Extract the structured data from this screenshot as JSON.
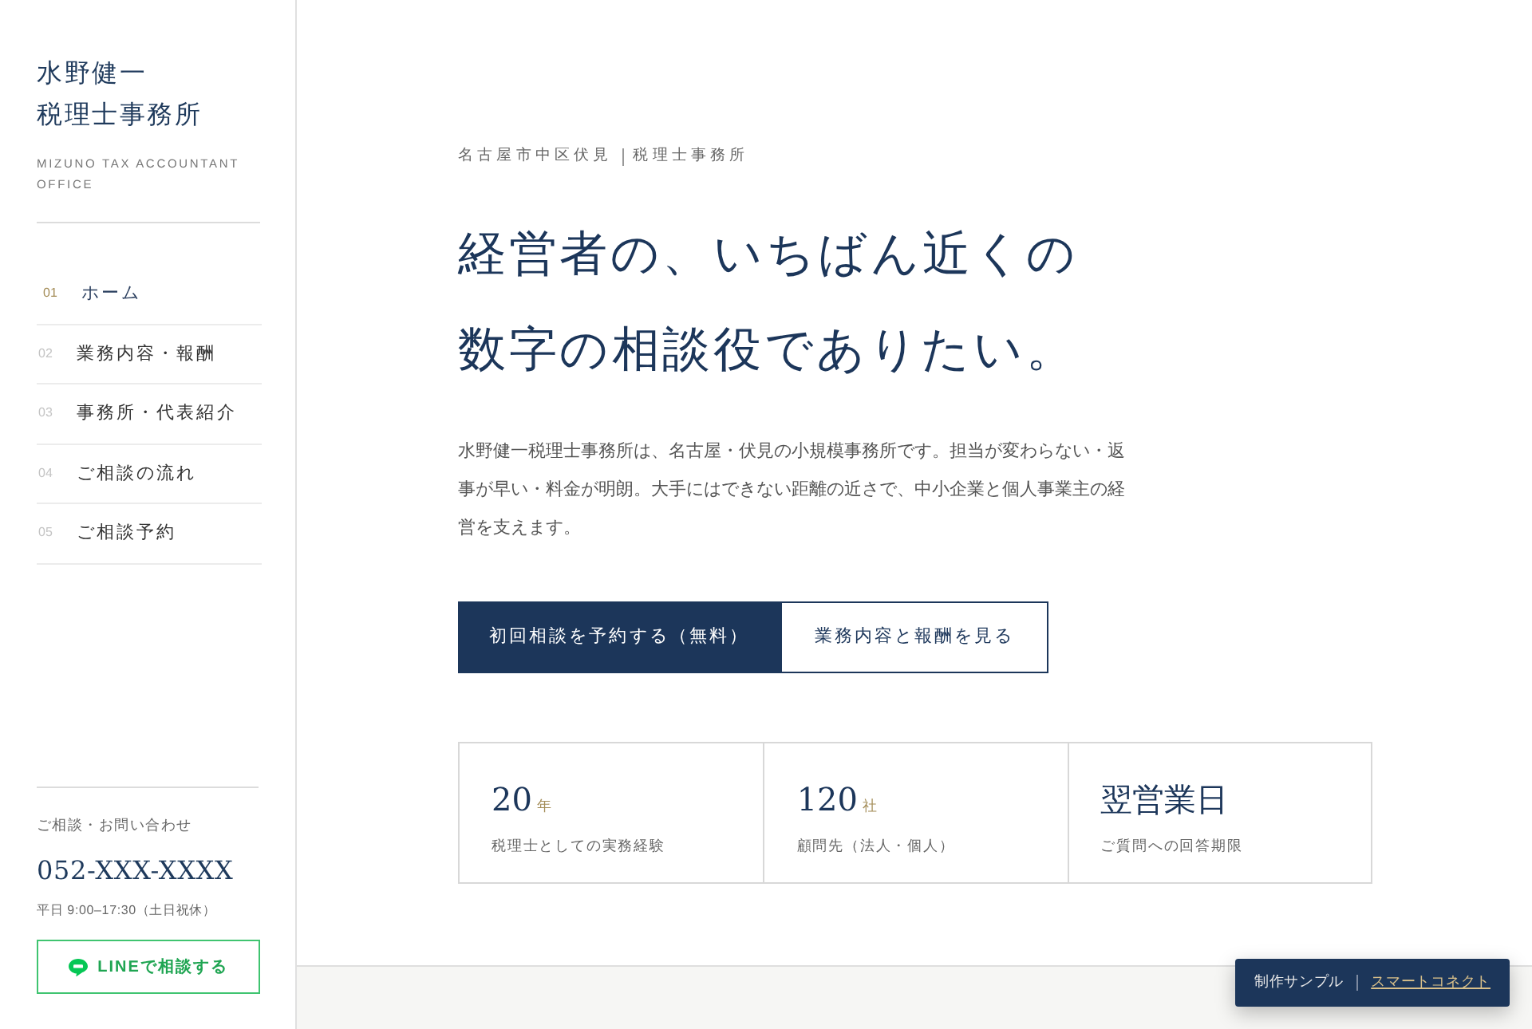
{
  "sidebar": {
    "brand": {
      "name_lines": [
        "水野健一",
        "税理士事務所"
      ],
      "subtitle": "MIZUNO TAX ACCOUNTANT OFFICE"
    },
    "nav": [
      {
        "number": "01",
        "label": "ホーム",
        "selected": true
      },
      {
        "number": "02",
        "label": "業務内容・報酬",
        "selected": false
      },
      {
        "number": "03",
        "label": "事務所・代表紹介",
        "selected": false
      },
      {
        "number": "04",
        "label": "ご相談の流れ",
        "selected": false
      },
      {
        "number": "05",
        "label": "ご相談予約",
        "selected": false
      }
    ],
    "contact": {
      "heading": "ご相談・お問い合わせ",
      "phone": "052-XXX-XXXX",
      "hours": "平日 9:00–17:30（土日祝休）",
      "line_button": "LINEで相談する"
    }
  },
  "hero": {
    "eyebrow": [
      "名古屋市中区伏見",
      "税理士事務所"
    ],
    "headline_lines": [
      "経営者の、いちばん近くの",
      "数字の相談役でありたい。"
    ],
    "lead": "水野健一税理士事務所は、名古屋・伏見の小規模事務所です。担当が変わらない・返事が早い・料金が明朗。大手にはできない距離の近さで、中小企業と個人事業主の経営を支えます。",
    "buttons": [
      {
        "label": "初回相談を予約する（無料）",
        "kind": "primary"
      },
      {
        "label": "業務内容と報酬を見る",
        "kind": "outline"
      }
    ]
  },
  "stats": [
    {
      "value": "20",
      "unit": "年",
      "label": "税理士としての実務経験"
    },
    {
      "value": "120",
      "unit": "社",
      "label": "顧問先（法人・個人）"
    },
    {
      "value": "翌営業日",
      "label": "ご質問への回答期限"
    }
  ],
  "footer_badge": {
    "text": "制作サンプル",
    "link": "スマートコネクト"
  }
}
